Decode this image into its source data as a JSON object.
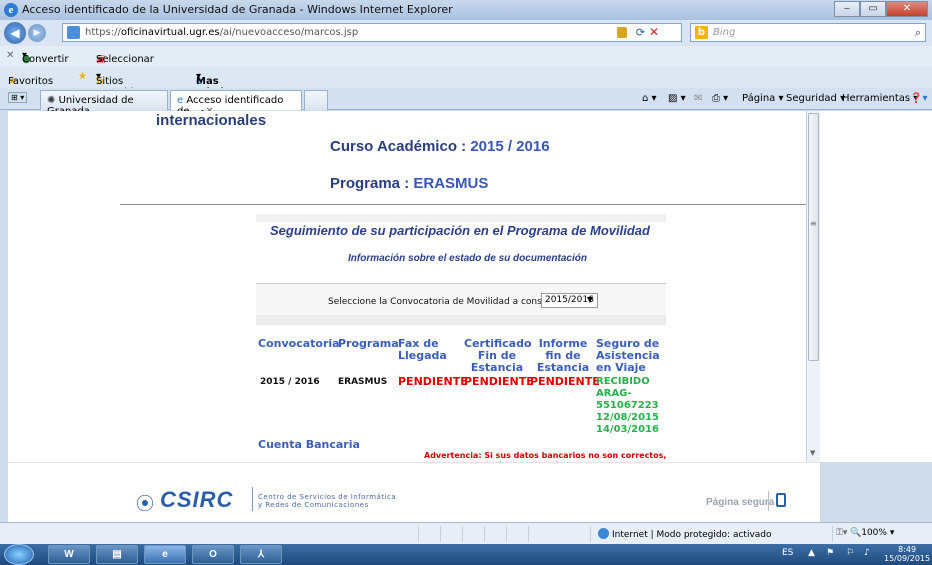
{
  "window": {
    "title": "Acceso identificado de la Universidad de Granada - Windows Internet Explorer"
  },
  "addressbar": {
    "url_prefix": "https://",
    "url_domain": "oficinavirtual.ugr.es",
    "url_path": "/ai/nuevoacceso/marcos.jsp",
    "search_placeholder": "Bing"
  },
  "commandbar": {
    "convertir": "Convertir",
    "seleccionar": "Seleccionar"
  },
  "favbar": {
    "favoritos": "Favoritos",
    "sitios": "Sitios sugeridos",
    "mas": "Mas admite el riesgo ..."
  },
  "tabs": {
    "items": [
      {
        "label": "Universidad de Granada"
      },
      {
        "label": "Acceso identificado de ..."
      }
    ],
    "pagina": "Página",
    "seguridad": "Seguridad",
    "herramientas": "Herramientas"
  },
  "page": {
    "internacionales": "internacionales",
    "curso_label": "Curso Académico : ",
    "curso_value": "2015 / 2016",
    "programa_label": "Programa : ",
    "programa_value": "ERASMUS",
    "seguimiento": "Seguimiento de su participación en el Programa de Movilidad",
    "informacion": "Información sobre el estado de su documentación",
    "select_label": "Seleccione la Convocatoria de Movilidad a consultar",
    "select_value": "2015/2016",
    "table": {
      "headers": [
        "Convocatoria",
        "Programa",
        "Fax de Llegada",
        "Certificado Fin de Estancia",
        "Informe fin de Estancia",
        "Seguro de Asistencia en Viaje"
      ],
      "row": {
        "convocatoria": "2015 / 2016",
        "programa": "ERASMUS",
        "fax": "PENDIENTE",
        "certificado": "PENDIENTE",
        "informe": "PENDIENTE",
        "seguro": [
          "RECIBIDO",
          "ARAG-",
          "551067223",
          "12/08/2015",
          "14/03/2016"
        ]
      }
    },
    "cuenta_bancaria": "Cuenta Bancaria",
    "advertencia": "Advertencia: Si sus datos bancarios no son correctos, por favor, actualícelos a través del procedimiento telemático"
  },
  "footer": {
    "csirc": "CSIRC",
    "csirc_line1": "Centro de Servicios de Informática",
    "csirc_line2": "y Redes de Comunicaciones",
    "pagina_segura": "Página segura"
  },
  "statusbar": {
    "zone": "Internet | Modo protegido: activado",
    "zoom": "100%"
  },
  "taskbar": {
    "lang": "ES",
    "time": "8:49",
    "date": "15/09/2015"
  },
  "colors": {
    "heading": "#2a3f7a",
    "link_blue": "#3a5fb5",
    "pending_red": "#e00000",
    "received_green": "#27b04b"
  }
}
